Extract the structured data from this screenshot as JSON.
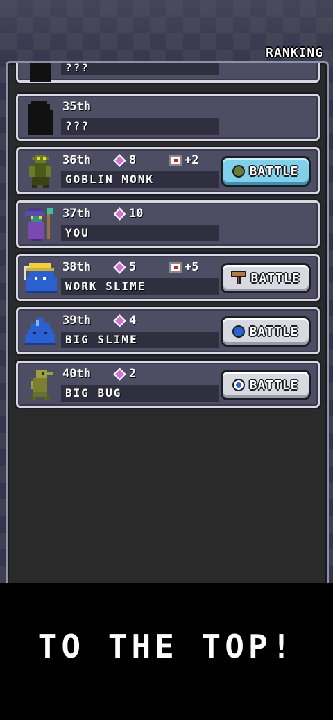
{
  "header": {
    "ranking_label": "RANKING"
  },
  "rows": [
    {
      "name": "???",
      "rank": "",
      "portrait": "silhouette-icon"
    },
    {
      "rank": "35th",
      "name": "???",
      "portrait": "silhouette-icon"
    },
    {
      "rank": "36th",
      "gems": "8",
      "bonus": "+2",
      "name": "GOBLIN MONK",
      "portrait": "goblin-monk-icon",
      "button": "BATTLE",
      "button_style": "blue",
      "button_icon_color": "#6a7a3a"
    },
    {
      "rank": "37th",
      "gems": "10",
      "name": "YOU",
      "portrait": "wizard-icon"
    },
    {
      "rank": "38th",
      "gems": "5",
      "bonus": "+5",
      "name": "WORK SLIME",
      "portrait": "work-slime-icon",
      "button": "BATTLE",
      "button_style": "gray",
      "button_icon_color": "#a06a3a"
    },
    {
      "rank": "39th",
      "gems": "4",
      "name": "BIG SLIME",
      "portrait": "big-slime-icon",
      "button": "BATTLE",
      "button_style": "gray",
      "button_icon_color": "#2a62c8"
    },
    {
      "rank": "40th",
      "gems": "2",
      "name": "BIG BUG",
      "portrait": "big-bug-icon",
      "button": "BATTLE",
      "button_style": "gray",
      "button_icon_color": "#2a62c8"
    }
  ],
  "colors": {
    "gem": "#d070d8",
    "blue_button": "#7fd0e8",
    "gray_button": "#d8d8e0"
  },
  "footer": {
    "text": "TO THE TOP!"
  }
}
